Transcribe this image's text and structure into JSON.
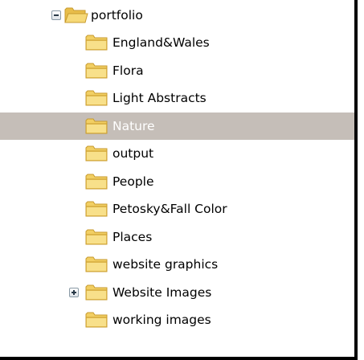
{
  "tree": {
    "root": {
      "label": "portfolio",
      "expanded": true,
      "icon": "open-folder-icon"
    },
    "children": [
      {
        "label": "England&Wales",
        "selected": false,
        "has_children": false,
        "icon": "folder-icon"
      },
      {
        "label": "Flora",
        "selected": false,
        "has_children": false,
        "icon": "folder-icon"
      },
      {
        "label": "Light Abstracts",
        "selected": false,
        "has_children": false,
        "icon": "folder-icon"
      },
      {
        "label": "Nature",
        "selected": true,
        "has_children": false,
        "icon": "folder-icon"
      },
      {
        "label": "output",
        "selected": false,
        "has_children": false,
        "icon": "folder-icon"
      },
      {
        "label": "People",
        "selected": false,
        "has_children": false,
        "icon": "folder-icon"
      },
      {
        "label": "Petosky&Fall Color",
        "selected": false,
        "has_children": false,
        "icon": "folder-icon"
      },
      {
        "label": "Places",
        "selected": false,
        "has_children": false,
        "icon": "folder-icon"
      },
      {
        "label": "website graphics",
        "selected": false,
        "has_children": false,
        "icon": "folder-icon"
      },
      {
        "label": "Website Images",
        "selected": false,
        "has_children": true,
        "expanded": false,
        "icon": "folder-icon"
      },
      {
        "label": "working images",
        "selected": false,
        "has_children": false,
        "icon": "folder-icon"
      }
    ]
  },
  "colors": {
    "selection_background": "#c5beb8",
    "selection_text": "#ffffff",
    "folder_fill": "#f2cf63",
    "folder_edge": "#c79a2c"
  }
}
